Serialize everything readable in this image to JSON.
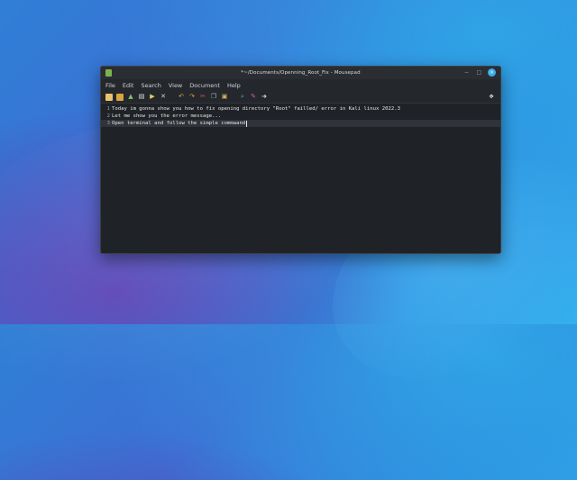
{
  "window": {
    "title": "*~/Documents/Openning_Root_Fix - Mousepad"
  },
  "menu": {
    "items": [
      "File",
      "Edit",
      "Search",
      "View",
      "Document",
      "Help"
    ]
  },
  "editor": {
    "lines": [
      {
        "number": "1",
        "text": "Today im gonna show you how to fix opening directory \"Root\" failled/ error in Kali linux 2022.3"
      },
      {
        "number": "2",
        "text": "Let me show you the error message..."
      },
      {
        "number": "3",
        "text": "Open terminal and follow the simple commaand"
      }
    ]
  },
  "colors": {
    "accent": "#3daee9",
    "editor_bg": "#1f2226",
    "current_line": "#30343a"
  }
}
